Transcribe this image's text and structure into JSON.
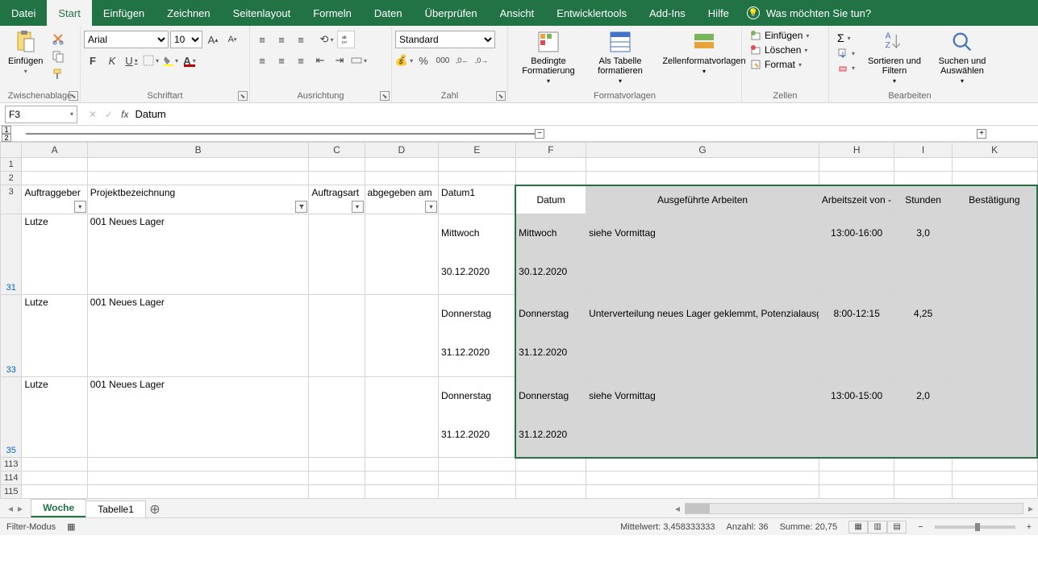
{
  "tabs": [
    "Datei",
    "Start",
    "Einfügen",
    "Zeichnen",
    "Seitenlayout",
    "Formeln",
    "Daten",
    "Überprüfen",
    "Ansicht",
    "Entwicklertools",
    "Add-Ins",
    "Hilfe"
  ],
  "active_tab": "Start",
  "tell_me": "Was möchten Sie tun?",
  "groups": {
    "clipboard": {
      "label": "Zwischenablage",
      "paste": "Einfügen"
    },
    "font": {
      "label": "Schriftart",
      "name": "Arial",
      "size": "10",
      "bold": "F",
      "italic": "K",
      "underline": "U"
    },
    "alignment": {
      "label": "Ausrichtung"
    },
    "number": {
      "label": "Zahl",
      "format": "Standard"
    },
    "styles": {
      "label": "Formatvorlagen",
      "cond": "Bedingte Formatierung",
      "table": "Als Tabelle formatieren",
      "cell": "Zellenformatvorlagen"
    },
    "cells": {
      "label": "Zellen",
      "insert": "Einfügen",
      "delete": "Löschen",
      "format": "Format"
    },
    "editing": {
      "label": "Bearbeiten",
      "sort": "Sortieren und Filtern",
      "find": "Suchen und Auswählen"
    }
  },
  "namebox": "F3",
  "formula": "Datum",
  "columns": [
    "A",
    "B",
    "C",
    "D",
    "E",
    "F",
    "G",
    "H",
    "I",
    "K"
  ],
  "header_row": {
    "A": "Auftraggeber",
    "B": "Projektbezeichnung",
    "C": "Auftragsart",
    "D": "abgegeben am",
    "E": "Datum1",
    "F": "Datum",
    "G": "Ausgeführte Arbeiten",
    "H": "Arbeitszeit von - bis",
    "I": "Stunden",
    "K": "Bestätigung"
  },
  "rows": [
    {
      "num": "31",
      "A": "Lutze",
      "B": "001 Neues Lager",
      "E1": "Mittwoch",
      "E2": "30.12.2020",
      "F1": "Mittwoch",
      "F2": "30.12.2020",
      "G": "siehe Vormittag",
      "H": "13:00-16:00",
      "I": "3,0"
    },
    {
      "num": "33",
      "A": "Lutze",
      "B": "001 Neues Lager",
      "E1": "Donnerstag",
      "E2": "31.12.2020",
      "F1": "Donnerstag",
      "F2": "31.12.2020",
      "G": "Unterverteilung neues Lager geklemmt, Potenzialausgleichsschiene gesetzt und angeschlossen, mit Relux Lager berechnet - Apollon 625x625 gewählt, Wohnung oben Steckdose Bad geklemmt, Kabel gesucht",
      "H": "8:00-12:15",
      "I": "4,25"
    },
    {
      "num": "35",
      "A": "Lutze",
      "B": "001 Neues Lager",
      "E1": "Donnerstag",
      "E2": "31.12.2020",
      "F1": "Donnerstag",
      "F2": "31.12.2020",
      "G": "siehe Vormittag",
      "H": "13:00-15:00",
      "I": "2,0"
    }
  ],
  "empty_rows": [
    "1",
    "2"
  ],
  "post_rows": [
    "113",
    "114",
    "115"
  ],
  "sheets": [
    "Woche",
    "Tabelle1"
  ],
  "active_sheet": "Woche",
  "status": {
    "mode": "Filter-Modus",
    "avg_label": "Mittelwert:",
    "avg": "3,458333333",
    "count_label": "Anzahl:",
    "count": "36",
    "sum_label": "Summe:",
    "sum": "20,75"
  }
}
